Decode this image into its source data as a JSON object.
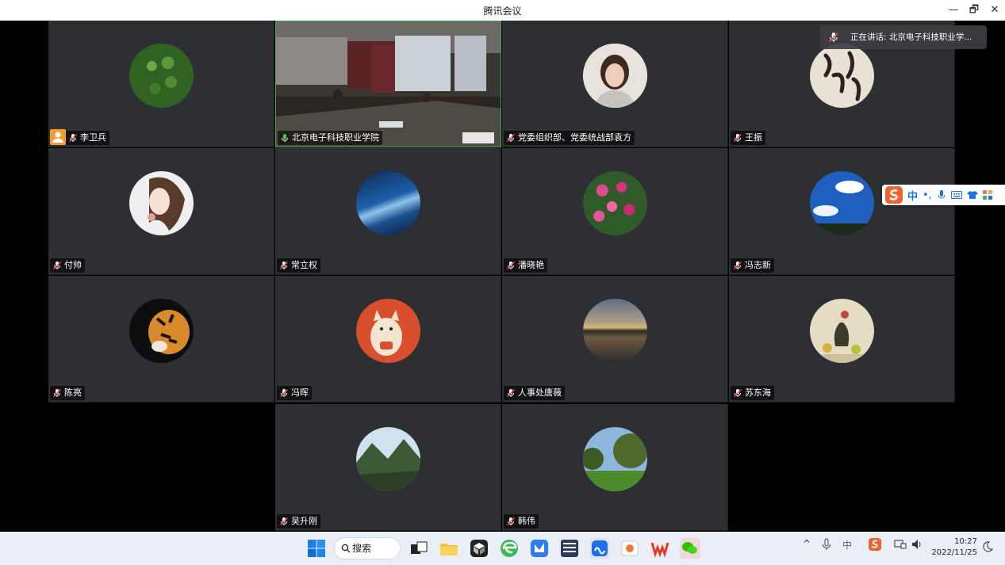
{
  "window": {
    "title": "腾讯会议"
  },
  "speaking": {
    "text": "正在讲话: 北京电子科技职业学..."
  },
  "participants": [
    {
      "name": "李卫兵",
      "avatar": "green-leaves-avatar"
    },
    {
      "name": "北京电子科技职业学院",
      "avatar": "meeting-room-video"
    },
    {
      "name": "党委组织部、党委统战部袁方",
      "avatar": "woman-photo-avatar"
    },
    {
      "name": "王振",
      "avatar": "calligraphy-avatar"
    },
    {
      "name": "付帅",
      "avatar": "anime-girl-avatar"
    },
    {
      "name": "常立权",
      "avatar": "blue-galaxy-avatar"
    },
    {
      "name": "潘晓艳",
      "avatar": "pink-flowers-avatar"
    },
    {
      "name": "冯志新",
      "avatar": "blue-sky-avatar"
    },
    {
      "name": "陈亮",
      "avatar": "tiger-avatar"
    },
    {
      "name": "冯晖",
      "avatar": "cartoon-cat-avatar"
    },
    {
      "name": "人事处唐薇",
      "avatar": "sunset-lake-avatar"
    },
    {
      "name": "苏东海",
      "avatar": "still-life-avatar"
    },
    {
      "name": "吴升刚",
      "avatar": "mountain-avatar"
    },
    {
      "name": "韩伟",
      "avatar": "park-tree-avatar"
    }
  ],
  "ime": {
    "mode": "中"
  },
  "taskbar": {
    "search_label": "搜索",
    "tray_lang": "中",
    "time": "10:27",
    "date": "2022/11/25"
  },
  "colors": {
    "tile_bg": "#2d2f33",
    "active_border": "#3fae49",
    "host_badge": "#f39c2b"
  }
}
